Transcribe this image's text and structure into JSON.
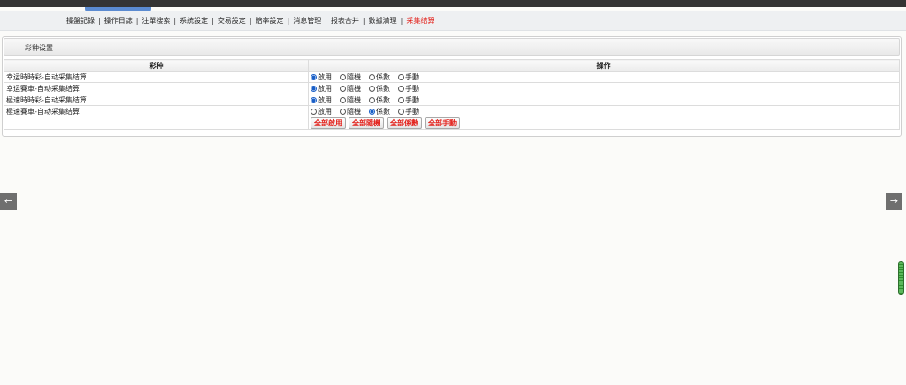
{
  "nav": {
    "items": [
      {
        "label": "操盤記錄",
        "active": false
      },
      {
        "label": "操作日誌",
        "active": false
      },
      {
        "label": "注單搜索",
        "active": false
      },
      {
        "label": "系統設定",
        "active": false
      },
      {
        "label": "交易設定",
        "active": false
      },
      {
        "label": "賠率設定",
        "active": false
      },
      {
        "label": "消息管理",
        "active": false
      },
      {
        "label": "报表合并",
        "active": false
      },
      {
        "label": "數據清理",
        "active": false
      },
      {
        "label": "采集结算",
        "active": true
      }
    ],
    "separator": "|"
  },
  "panel": {
    "title": "彩种设置"
  },
  "table": {
    "headers": {
      "name": "彩种",
      "ops": "操作"
    },
    "options": [
      "啟用",
      "隨機",
      "係數",
      "手動"
    ],
    "rows": [
      {
        "name": "幸运時時彩-自动采集结算",
        "selected": 0
      },
      {
        "name": "幸运賽車-自动采集结算",
        "selected": 0
      },
      {
        "name": "極速時時彩-自动采集结算",
        "selected": 0
      },
      {
        "name": "極速賽車-自动采集结算",
        "selected": 2
      }
    ],
    "buttons": [
      "全部啟用",
      "全部隨機",
      "全部係數",
      "全部手動"
    ]
  },
  "arrows": {
    "left": "←",
    "right": "→"
  },
  "colors": {
    "active_nav": "#e3221c",
    "button_text": "#e3221c",
    "radio_checked": "#1a5fc7"
  }
}
